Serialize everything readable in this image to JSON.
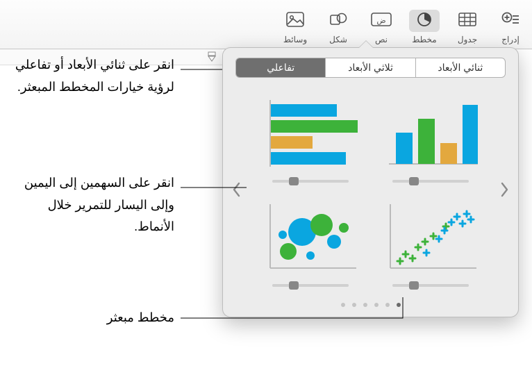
{
  "toolbar": {
    "items": [
      {
        "id": "media",
        "label": "وسائط"
      },
      {
        "id": "shape",
        "label": "شكل"
      },
      {
        "id": "text",
        "label": "نص"
      },
      {
        "id": "chart",
        "label": "مخطط"
      },
      {
        "id": "table",
        "label": "جدول"
      },
      {
        "id": "insert",
        "label": "إدراج"
      }
    ],
    "active": "chart"
  },
  "popover": {
    "tabs": {
      "two_d": "ثنائي الأبعاد",
      "three_d": "ثلاثي الأبعاد",
      "interactive": "تفاعلي"
    },
    "selected_tab": "interactive",
    "thumbs": {
      "column": "مخطط أعمدة تفاعلي",
      "bar": "مخطط شريطي تفاعلي",
      "scatter": "مخطط مبعثر تفاعلي",
      "bubble": "مخطط فقاعي تفاعلي"
    },
    "page_dots": 6,
    "active_dot": 5
  },
  "callouts": {
    "tabs_hint": "انقر على ثنائي الأبعاد أو تفاعلي لرؤية خيارات المخطط المبعثر.",
    "arrows_hint": "انقر على السهمين إلى اليمين وإلى اليسار للتمرير خلال الأنماط.",
    "scatter_label": "مخطط مبعثر"
  },
  "colors": {
    "blue": "#0aa6e0",
    "green": "#3db23a",
    "gold": "#e3a83e"
  }
}
